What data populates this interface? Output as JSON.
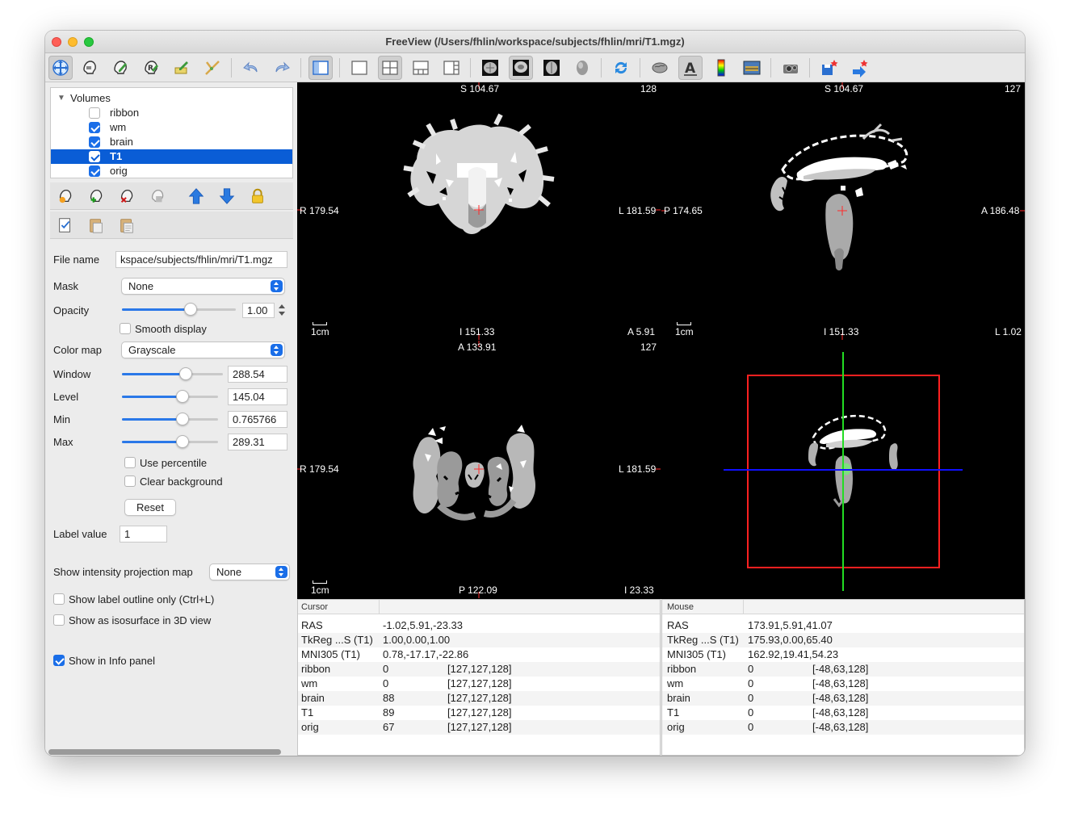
{
  "window": {
    "title": "FreeView (/Users/fhlin/workspace/subjects/fhlin/mri/T1.mgz)"
  },
  "toolbar": {
    "buttons": [
      {
        "name": "navigate-tool-icon"
      },
      {
        "name": "voxel-edit-icon"
      },
      {
        "name": "recon-edit-icon"
      },
      {
        "name": "roi-edit-icon"
      },
      {
        "name": "point-set-edit-icon"
      },
      {
        "name": "contour-tool-icon"
      },
      {
        "name": "undo-icon"
      },
      {
        "name": "redo-icon"
      },
      {
        "name": "toggle-panel-icon"
      },
      {
        "name": "layout-1x1-icon"
      },
      {
        "name": "layout-2x2-icon"
      },
      {
        "name": "layout-1-3-icon"
      },
      {
        "name": "layout-1-3-horizontal-icon"
      },
      {
        "name": "view-sagittal-icon"
      },
      {
        "name": "view-coronal-icon"
      },
      {
        "name": "view-axial-icon"
      },
      {
        "name": "view-3d-icon"
      },
      {
        "name": "reset-view-icon"
      },
      {
        "name": "show-surface-icon"
      },
      {
        "name": "show-annotation-text-icon"
      },
      {
        "name": "show-color-scale-icon"
      },
      {
        "name": "show-info-panel-icon"
      },
      {
        "name": "snapshot-icon"
      },
      {
        "name": "save-point-icon"
      },
      {
        "name": "goto-point-icon"
      }
    ]
  },
  "layers": {
    "group_label": "Volumes",
    "items": [
      {
        "label": "ribbon",
        "checked": false,
        "selected": false
      },
      {
        "label": "wm",
        "checked": true,
        "selected": false
      },
      {
        "label": "brain",
        "checked": true,
        "selected": false
      },
      {
        "label": "T1",
        "checked": true,
        "selected": true
      },
      {
        "label": "orig",
        "checked": true,
        "selected": false
      }
    ]
  },
  "properties": {
    "file_name_label": "File name",
    "file_name_value": "kspace/subjects/fhlin/mri/T1.mgz",
    "mask_label": "Mask",
    "mask_value": "None",
    "opacity_label": "Opacity",
    "opacity_value": "1.00",
    "opacity_level": 0.6,
    "smooth_display_label": "Smooth display",
    "smooth_display_checked": false,
    "color_map_label": "Color map",
    "color_map_value": "Grayscale",
    "window_label": "Window",
    "window_value": "288.54",
    "window_level": 0.63,
    "level_label": "Level",
    "level_value": "145.04",
    "level_level": 0.63,
    "min_label": "Min",
    "min_value": "0.765766",
    "min_level": 0.63,
    "max_label": "Max",
    "max_value": "289.31",
    "max_level": 0.63,
    "use_percentile_label": "Use percentile",
    "clear_background_label": "Clear background",
    "reset_label": "Reset",
    "label_value_label": "Label value",
    "label_value_value": "1",
    "projection_label": "Show intensity projection map",
    "projection_value": "None",
    "label_outline_label": "Show label outline only (Ctrl+L)",
    "isosurface_label": "Show as isosurface in 3D view",
    "show_info_label": "Show in Info panel",
    "show_info_checked": true
  },
  "views": {
    "coronal": {
      "top": "S 104.67",
      "slice": "128",
      "left": "R 179.54",
      "right": "L 181.59",
      "bottom": "I 151.33",
      "bottom_right": "A 5.91",
      "scale": "1cm"
    },
    "sagittal": {
      "top": "S 104.67",
      "slice": "127",
      "left": "P 174.65",
      "right": "A 186.48",
      "bottom": "I 151.33",
      "bottom_right": "L 1.02",
      "scale": "1cm"
    },
    "axial": {
      "top": "A 133.91",
      "slice": "127",
      "left": "R 179.54",
      "right": "L 181.59",
      "bottom": "P 122.09",
      "bottom_right": "I 23.33",
      "scale": "1cm"
    }
  },
  "info_cursor": {
    "header": "Cursor",
    "rows": [
      {
        "name": "RAS",
        "value": "-1.02,5.91,-23.33",
        "coord": ""
      },
      {
        "name": "TkReg ...S (T1)",
        "value": "1.00,0.00,1.00",
        "coord": ""
      },
      {
        "name": "MNI305 (T1)",
        "value": "0.78,-17.17,-22.86",
        "coord": ""
      },
      {
        "name": "ribbon",
        "value": "0",
        "coord": "[127,127,128]"
      },
      {
        "name": "wm",
        "value": "0",
        "coord": "[127,127,128]"
      },
      {
        "name": "brain",
        "value": "88",
        "coord": "[127,127,128]"
      },
      {
        "name": "T1",
        "value": "89",
        "coord": "[127,127,128]"
      },
      {
        "name": "orig",
        "value": "67",
        "coord": "[127,127,128]"
      }
    ]
  },
  "info_mouse": {
    "header": "Mouse",
    "rows": [
      {
        "name": "RAS",
        "value": "173.91,5.91,41.07",
        "coord": ""
      },
      {
        "name": "TkReg ...S (T1)",
        "value": "175.93,0.00,65.40",
        "coord": ""
      },
      {
        "name": "MNI305 (T1)",
        "value": "162.92,19.41,54.23",
        "coord": ""
      },
      {
        "name": "ribbon",
        "value": "0",
        "coord": "[-48,63,128]"
      },
      {
        "name": "wm",
        "value": "0",
        "coord": "[-48,63,128]"
      },
      {
        "name": "brain",
        "value": "0",
        "coord": "[-48,63,128]"
      },
      {
        "name": "T1",
        "value": "0",
        "coord": "[-48,63,128]"
      },
      {
        "name": "orig",
        "value": "0",
        "coord": "[-48,63,128]"
      }
    ]
  },
  "colors": {
    "selection": "#0a5dd6",
    "accent": "#1a6ee8",
    "cursor": "#ff0000",
    "axis_green": "#00d000",
    "axis_blue": "#0000ff"
  }
}
